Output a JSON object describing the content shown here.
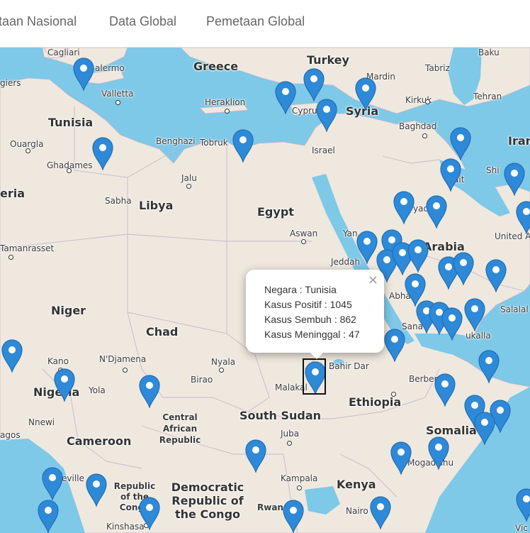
{
  "nav": {
    "items": [
      "taan Nasional",
      "Data Global",
      "Pemetaan Global"
    ]
  },
  "map": {
    "labels": {
      "turkey": "Turkey",
      "greece": "Greece",
      "tunisia": "Tunisia",
      "libya": "Libya",
      "egypt": "Egypt",
      "syria": "Syria",
      "israel": "Israel",
      "cyprus": "Cyprus",
      "iran": "Iran",
      "arabia": "Arabia",
      "niger": "Niger",
      "chad": "Chad",
      "nigeria": "Nigeria",
      "cameroon": "Cameroon",
      "ethiopia": "Ethiopia",
      "south_sudan": "South Sudan",
      "somalia": "Somalia",
      "kenya": "Kenya",
      "car": "Central African Republic",
      "drc": "Democratic Republic of the Congo",
      "roc": "Republic of the Congo",
      "rwanda": "Rwanda",
      "uae": "United Arab Emirates",
      "eria": "eria",
      "cagliari": "Cagliari",
      "palermo": "alermo",
      "valletta": "Valletta",
      "heraklion": "Heraklion",
      "benghazi": "Benghazi",
      "tobruk": "Tobruk",
      "ouargla": "Ouargla",
      "ghadames": "Ghadames",
      "sabha": "Sabha",
      "jalu": "Jalu",
      "aswan": "Aswan",
      "tamanrasset": "Tamanrasset",
      "mardin": "Mardin",
      "tabriz": "Tabriz",
      "baku": "Baku",
      "kirkuk": "Kirkuk",
      "tehran": "Tehran",
      "baghdad": "Baghdad",
      "kuwait": "ait",
      "jeddah": "Jeddah",
      "yanbu": "Yan",
      "abha": "Abha",
      "sana": "Sana",
      "mukalla": "ukalla",
      "salalah": "Salalal",
      "bahir_dar": "Bahir Dar",
      "berbera": "Berber",
      "kano": "Kano",
      "ndjamena": "N'Djamena",
      "nyala": "Nyala",
      "birao": "Birao",
      "malakal": "Malakal",
      "yola": "Yola",
      "nnewi": "Nnewi",
      "juba": "Juba",
      "mogadishu": "Mogadishu",
      "kampala": "Kampala",
      "nairobi": "Nairo",
      "kinshasa": "Kinshasa",
      "gos": "agos",
      "giers": "giers",
      "shi": "Shi",
      "riyadh": "yad",
      "libreville": "eville",
      "vic": "Vic"
    }
  },
  "popup": {
    "negara": "Negara : Tunisia",
    "positif": "Kasus Positif : 1045",
    "sembuh": "Kasus Sembuh : 862",
    "meninggal": "Kasus Meninggal : 47",
    "close": "×"
  },
  "colors": {
    "sea": "#7ec8e8",
    "land": "#efe8df",
    "marker": "#2e8ad8",
    "marker_stroke": "#1e6fb0"
  }
}
